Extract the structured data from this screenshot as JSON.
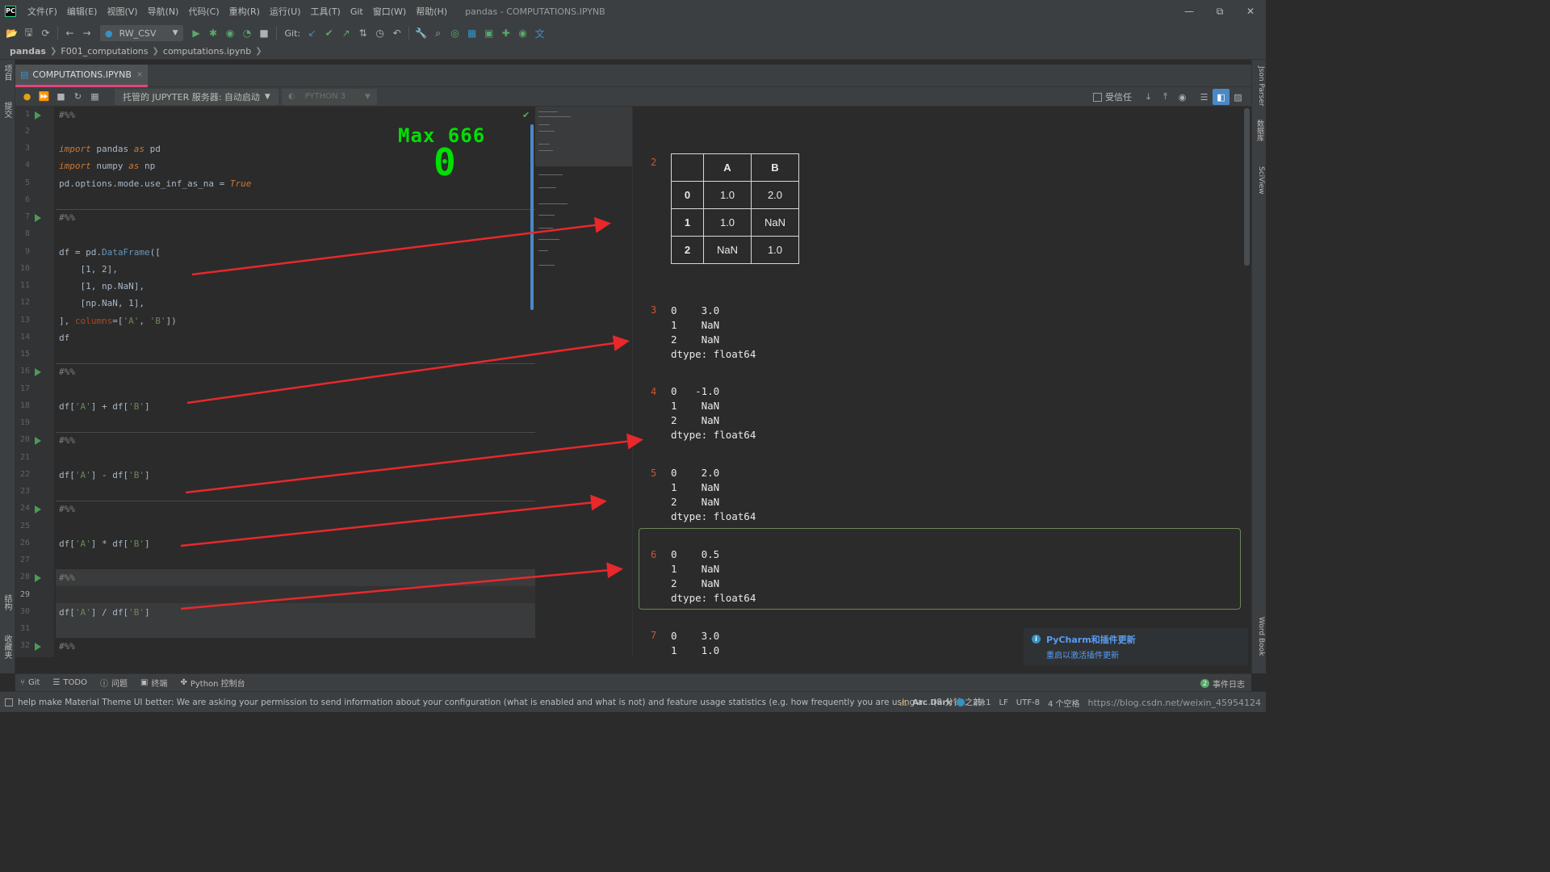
{
  "app": {
    "logo_text": "PC",
    "window_title": "pandas - COMPUTATIONS.IPYNB",
    "menu": [
      "文件(F)",
      "编辑(E)",
      "视图(V)",
      "导航(N)",
      "代码(C)",
      "重构(R)",
      "运行(U)",
      "工具(T)",
      "Git",
      "窗口(W)",
      "帮助(H)"
    ],
    "window_controls": {
      "minimize": "—",
      "restore": "⧉",
      "close": "✕"
    }
  },
  "toolbar": {
    "run_config": "RW_CSV",
    "git_label": "Git:"
  },
  "breadcrumb": [
    "pandas",
    "F001_computations",
    "computations.ipynb"
  ],
  "left_strip": {
    "project": "项目",
    "commit": "提交",
    "structure": "结构",
    "favorites": "收藏夹"
  },
  "right_strip": {
    "json_parser": "Json Parser",
    "database": "数据库",
    "sciview": "SciView",
    "word_book": "Word Book"
  },
  "editor_tab": {
    "label": "COMPUTATIONS.IPYNB",
    "close": "×"
  },
  "notebook_toolbar": {
    "server": "托管的 JUPYTER 服务器: 自动启动",
    "kernel": "PYTHON 3",
    "trusted": "受信任"
  },
  "editor": {
    "line_numbers": [
      "1",
      "2",
      "3",
      "4",
      "5",
      "6",
      "7",
      "8",
      "9",
      "10",
      "11",
      "12",
      "13",
      "14",
      "15",
      "16",
      "17",
      "18",
      "19",
      "20",
      "21",
      "22",
      "23",
      "24",
      "25",
      "26",
      "27",
      "28",
      "29",
      "30",
      "31",
      "32"
    ],
    "lines": {
      "l1": "#%%",
      "l3a": "import",
      "l3b": " pandas ",
      "l3c": "as",
      "l3d": " pd",
      "l4a": "import",
      "l4b": " numpy ",
      "l4c": "as",
      "l4d": " np",
      "l5a": "pd.options.mode.use_inf_as_na = ",
      "l5b": "True",
      "l7": "#%%",
      "l9a": "df = pd.",
      "l9b": "DataFrame",
      "l9c": "([",
      "l10": "    [1, 2],",
      "l11": "    [1, np.NaN],",
      "l12": "    [np.NaN, 1],",
      "l13a": "], ",
      "l13b": "columns",
      "l13c": "=[",
      "l13d": "'A'",
      "l13e": ", ",
      "l13f": "'B'",
      "l13g": "])",
      "l14": "df",
      "l16": "#%%",
      "l18a": "df[",
      "l18b": "'A'",
      "l18c": "] + df[",
      "l18d": "'B'",
      "l18e": "]",
      "l20": "#%%",
      "l22a": "df[",
      "l22b": "'A'",
      "l22c": "] - df[",
      "l22d": "'B'",
      "l22e": "]",
      "l24": "#%%",
      "l26a": "df[",
      "l26b": "'A'",
      "l26c": "] * df[",
      "l26d": "'B'",
      "l26e": "]",
      "l28": "#%%",
      "l30a": "df[",
      "l30b": "'A'",
      "l30c": "] / df[",
      "l30d": "'B'",
      "l30e": "]",
      "l32": "#%%"
    },
    "overlay_score": "Max 666",
    "overlay_count": "0",
    "check": "✔"
  },
  "output": {
    "out2": {
      "index": "2",
      "columns": [
        "",
        "A",
        "B"
      ],
      "rows": [
        [
          "0",
          "1.0",
          "2.0"
        ],
        [
          "1",
          "1.0",
          "NaN"
        ],
        [
          "2",
          "NaN",
          "1.0"
        ]
      ]
    },
    "out3": {
      "index": "3",
      "text": "0    3.0\n1    NaN\n2    NaN\ndtype: float64"
    },
    "out4": {
      "index": "4",
      "text": "0   -1.0\n1    NaN\n2    NaN\ndtype: float64"
    },
    "out5": {
      "index": "5",
      "text": "0    2.0\n1    NaN\n2    NaN\ndtype: float64"
    },
    "out6": {
      "index": "6",
      "text": "0    0.5\n1    NaN\n2    NaN\ndtype: float64"
    },
    "out7": {
      "index": "7",
      "text": "0    3.0\n1    1.0"
    }
  },
  "notification": {
    "title": "PyCharm和插件更新",
    "link": "重启以激活插件更新"
  },
  "bottom_bar": {
    "git": "Git",
    "todo": "TODO",
    "problems": "问题",
    "terminal": "终端",
    "python_console": "Python 控制台",
    "event_log_count": "2",
    "event_log": "事件日志"
  },
  "status": {
    "message": "help make Material Theme UI better: We are asking your permission to send information about your configuration (what is enabled and what is not) and feature usage statistics (e.g. how frequently you are using a... (9 分钟 之前)",
    "theme": "Arc Dark",
    "position": "29:1",
    "line_ending": "LF",
    "encoding": "UTF-8",
    "indent": "4 个空格",
    "watermark": "https://blog.csdn.net/weixin_45954124"
  }
}
